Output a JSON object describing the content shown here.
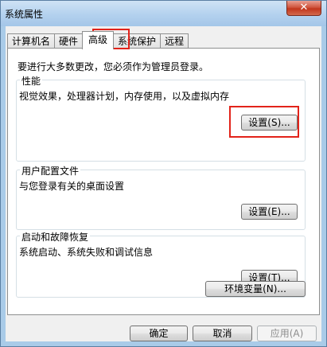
{
  "window": {
    "title": "系统属性",
    "close_icon": "✕"
  },
  "tabs": [
    {
      "label": "计算机名"
    },
    {
      "label": "硬件"
    },
    {
      "label": "高级"
    },
    {
      "label": "系统保护"
    },
    {
      "label": "远程"
    }
  ],
  "active_tab": "高级",
  "intro": "要进行大多数更改，您必须作为管理员登录。",
  "groups": {
    "performance": {
      "title": "性能",
      "desc": "视觉效果，处理器计划，内存使用，以及虚拟内存",
      "button": "设置(S)..."
    },
    "user_profiles": {
      "title": "用户配置文件",
      "desc": "与您登录有关的桌面设置",
      "button": "设置(E)..."
    },
    "startup_recovery": {
      "title": "启动和故障恢复",
      "desc": "系统启动、系统失败和调试信息",
      "button": "设置(T)..."
    }
  },
  "env_button": "环境变量(N)...",
  "footer": {
    "ok": "确定",
    "cancel": "取消",
    "apply": "应用(A)"
  },
  "colors": {
    "highlight": "#e2231a",
    "title_bar": "#b3d1ee",
    "close_button": "#c2361d"
  }
}
